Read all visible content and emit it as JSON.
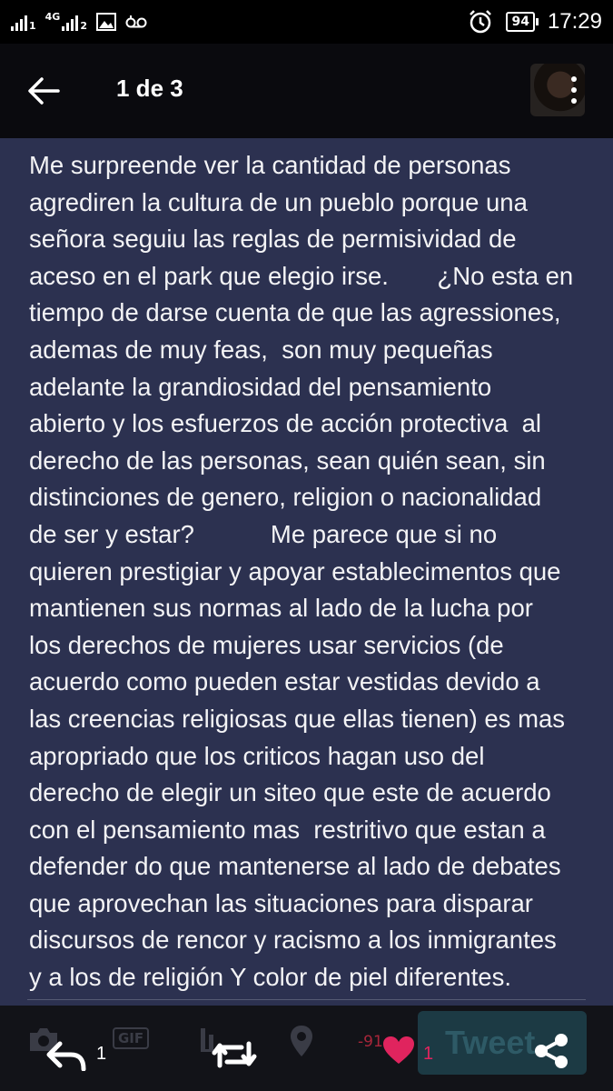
{
  "status_bar": {
    "network": "4G",
    "sim1_label": "1",
    "sim2_label": "2",
    "battery": "94",
    "time": "17:29",
    "icons": [
      "signal-icon",
      "signal-4g-icon",
      "image-icon",
      "voicemail-icon",
      "alarm-icon",
      "battery-icon"
    ]
  },
  "header": {
    "pager": "1 de 3"
  },
  "content": {
    "lines": [
      "Me surpreende ver la cantidad de personas",
      "agrediren la cultura de un pueblo porque una",
      "señora seguiu las reglas de permisividad de",
      "aceso en el park que elegio irse.       ¿No esta en",
      "tiempo de darse cuenta de que las agressiones,",
      "ademas de muy feas,  son muy pequeñas",
      "adelante la grandiosidad del pensamiento",
      "abierto y los esfuerzos de acción protectiva  al",
      "derecho de las personas, sean quién sean, sin",
      "distinciones de genero, religion o nacionalidad",
      "de ser y estar?           Me parece que si no",
      "quieren prestigiar y apoyar establecimentos que",
      "mantienen sus normas al lado de la lucha por",
      "los derechos de mujeres usar servicios (de",
      "acuerdo como pueden estar vestidas devido a",
      "las creencias religiosas que ellas tienen) es mas",
      "apropriado que los criticos hagan uso del",
      "derecho de elegir un siteo que este de acuerdo",
      "con el pensamiento mas  restritivo que estan a",
      "defender do que mantenerse al lado de debates",
      "que aprovechan las situaciones para disparar",
      "discursos de rencor y racismo a los inmigrantes",
      "y a los de religión Y color de piel diferentes."
    ]
  },
  "bottom_bar": {
    "reply_count": "1",
    "gif_label": "GIF",
    "minus_count": "-91",
    "like_count": "1",
    "tweet_label": "Tweet",
    "colors": {
      "like": "#e0245e",
      "text": "#ffffff"
    }
  }
}
